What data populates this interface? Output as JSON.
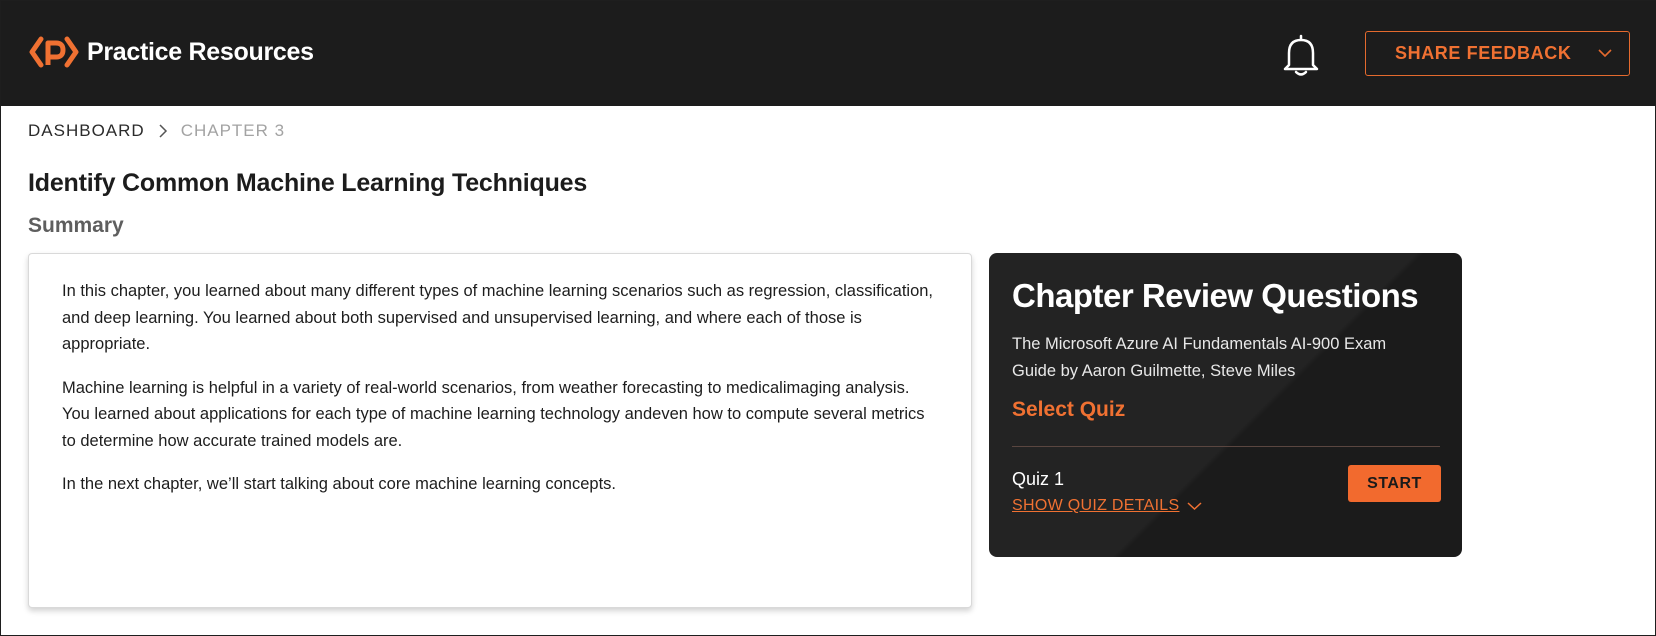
{
  "header": {
    "brand": "Practice Resources",
    "feedback_label": "SHARE FEEDBACK",
    "accent_color": "#f07132",
    "icons": [
      "packt-logo-icon",
      "bell-icon",
      "chevron-down-icon"
    ]
  },
  "breadcrumb": {
    "home": "DASHBOARD",
    "current": "CHAPTER 3"
  },
  "page": {
    "title": "Identify Common Machine Learning Techniques",
    "section": "Summary"
  },
  "summary": {
    "paragraphs": [
      "In this chapter, you learned about many different types of machine learning scenarios such as regression, classification, and deep learning. You learned about both supervised and unsupervised learning, and where each of those is appropriate.",
      "Machine learning is helpful in a variety of real-world scenarios, from weather forecasting to medicalimaging analysis. You learned about applications for each type of machine learning technology andeven how to compute several metrics to determine how accurate trained models are.",
      "In the next chapter, we’ll start talking about core machine learning concepts."
    ]
  },
  "review": {
    "title": "Chapter Review Questions",
    "book": "The Microsoft Azure AI Fundamentals AI-900 Exam Guide by Aaron Guilmette, Steve Miles",
    "select_quiz": "Select Quiz",
    "quiz_name": "Quiz 1",
    "details_label": "SHOW QUIZ DETAILS",
    "start_label": "START"
  }
}
